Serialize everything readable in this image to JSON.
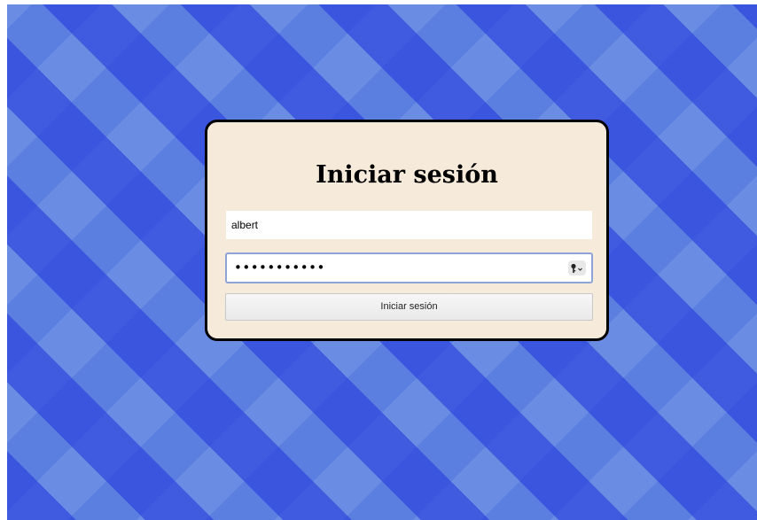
{
  "login": {
    "title": "Iniciar sesión",
    "username_value": "albert",
    "password_masked": "•••••••••••",
    "password_manager_icon": "key-icon",
    "submit_label": "Iniciar sesión"
  },
  "colors": {
    "card_background": "#f6eada",
    "card_border": "#000000",
    "background_primary": "#3550dc",
    "background_secondary": "#7b98e0",
    "focus_border": "#8ea4d6"
  }
}
